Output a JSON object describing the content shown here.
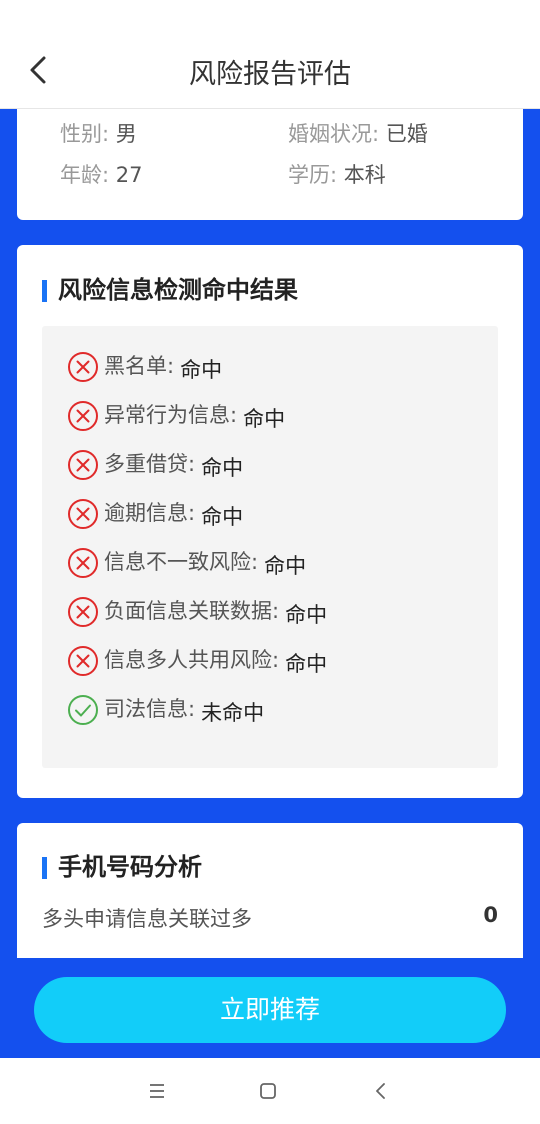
{
  "header": {
    "title": "风险报告评估",
    "back_icon": "chevron-left-icon"
  },
  "profile": {
    "gender_label": "性别:",
    "gender_value": "男",
    "marital_label": "婚姻状况:",
    "marital_value": "已婚",
    "age_label": "年龄:",
    "age_value": "27",
    "education_label": "学历:",
    "education_value": "本科"
  },
  "risk": {
    "title": "风险信息检测命中结果",
    "items": [
      {
        "name": "黑名单:",
        "value": "命中",
        "status": "hit"
      },
      {
        "name": "异常行为信息:",
        "value": "命中",
        "status": "hit"
      },
      {
        "name": "多重借贷:",
        "value": "命中",
        "status": "hit"
      },
      {
        "name": "逾期信息:",
        "value": "命中",
        "status": "hit"
      },
      {
        "name": "信息不一致风险:",
        "value": "命中",
        "status": "hit"
      },
      {
        "name": "负面信息关联数据:",
        "value": "命中",
        "status": "hit"
      },
      {
        "name": "信息多人共用风险:",
        "value": "命中",
        "status": "hit"
      },
      {
        "name": "司法信息:",
        "value": "未命中",
        "status": "clear"
      }
    ]
  },
  "phone": {
    "title": "手机号码分析",
    "row_label": "多头申请信息关联过多",
    "row_value": "0"
  },
  "footer": {
    "button_label": "立即推荐"
  },
  "colors": {
    "primary_bg": "#1450ee",
    "accent": "#12cdf9",
    "hit": "#e02a2a",
    "clear": "#4caf50"
  }
}
